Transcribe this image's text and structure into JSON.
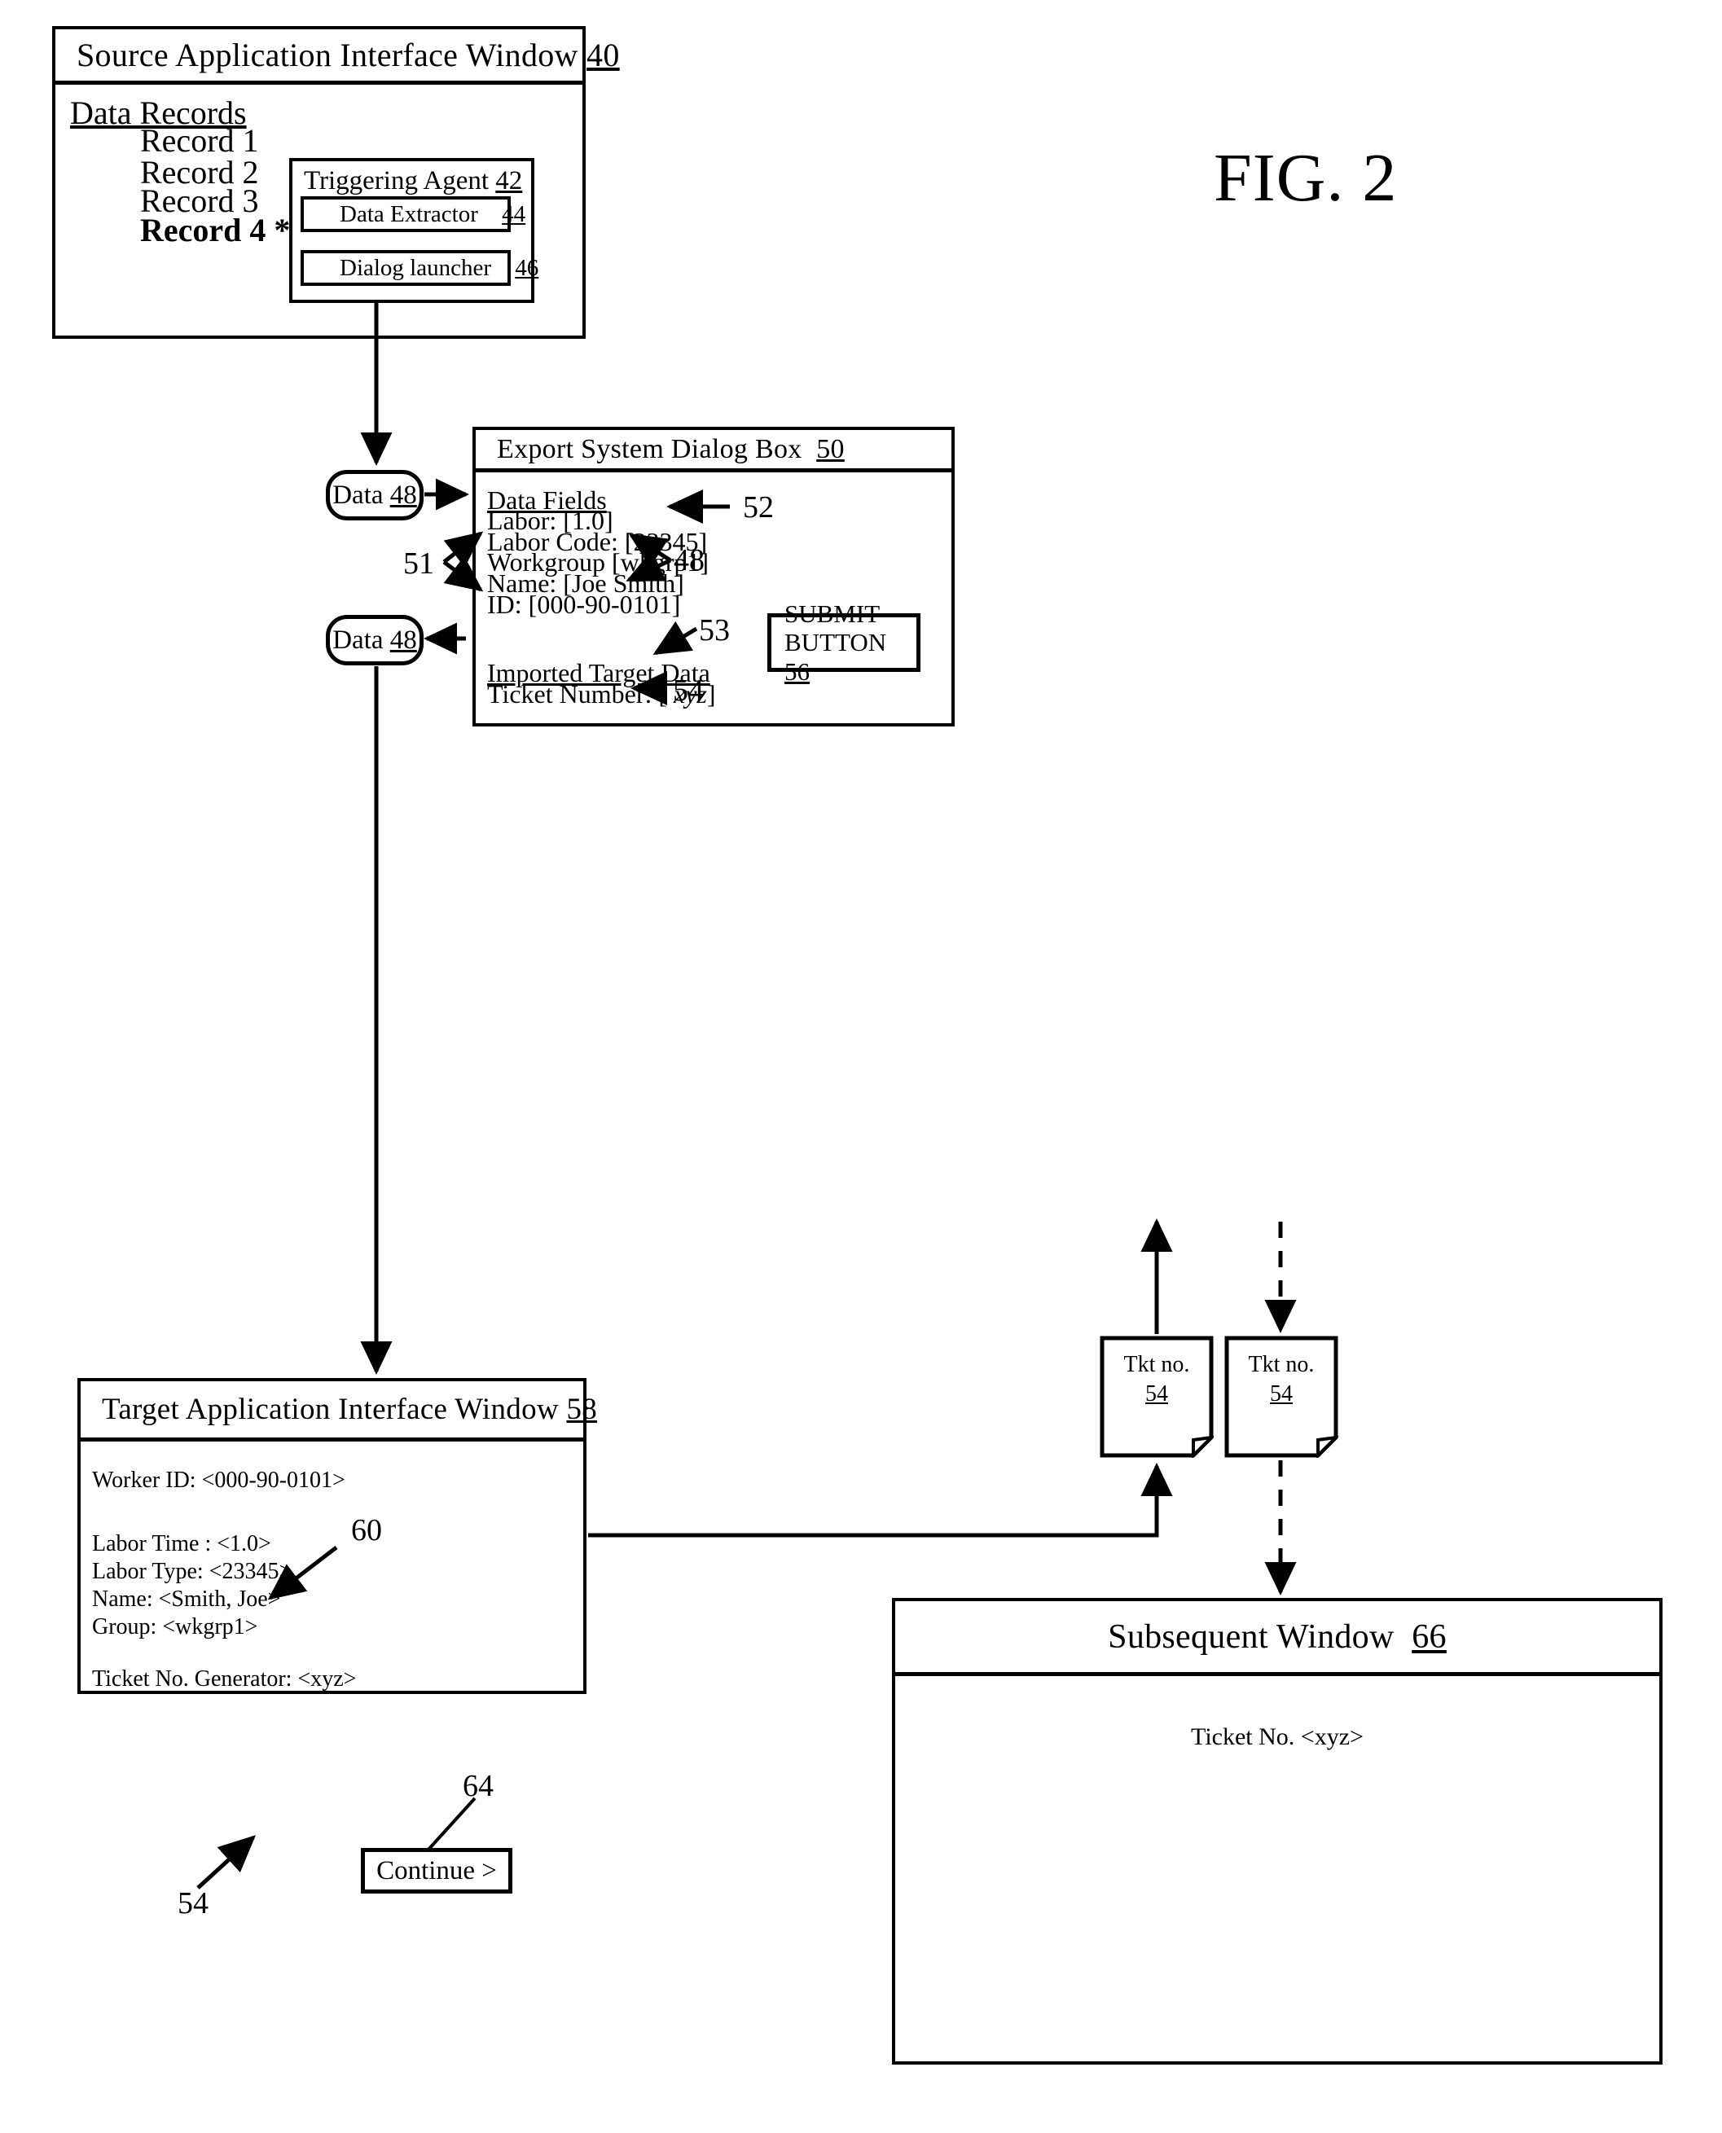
{
  "figure": {
    "label": "FIG. 2"
  },
  "source_window": {
    "title": "Source Application Interface Window 40",
    "title_text": "Source Application Interface Window",
    "title_ref": "40",
    "section_heading": "Data Records",
    "records": [
      {
        "label": "Record 1",
        "selected": false
      },
      {
        "label": "Record 2",
        "selected": false
      },
      {
        "label": "Record 3",
        "selected": false
      },
      {
        "label": "Record 4 *",
        "selected": true
      }
    ]
  },
  "triggering_agent": {
    "title_text": "Triggering Agent",
    "title_ref": "42",
    "components": [
      {
        "label_text": "Data Extractor",
        "ref": "44"
      },
      {
        "label_text": "Dialog launcher",
        "ref": "46"
      }
    ]
  },
  "data_nodes": [
    {
      "label_text": "Data",
      "ref": "48"
    },
    {
      "label_text": "Data",
      "ref": "48"
    }
  ],
  "export_dialog": {
    "title_text": "Export System Dialog Box",
    "title_ref": "50",
    "data_fields_heading": "Data Fields",
    "data_fields": [
      "Labor: [1.0]",
      "Labor Code: [23345]",
      "Workgroup [wkgrp1]",
      "Name: [Joe Smith]",
      "ID: [000-90-0101]"
    ],
    "imported_heading": "Imported Target Data",
    "imported_label": "Ticket Number: [ ",
    "imported_value": "xyz",
    "imported_close": "]",
    "submit_button_line1": "SUBMIT",
    "submit_button_line2": "BUTTON",
    "submit_button_ref": "56"
  },
  "target_window": {
    "title_text": "Target Application Interface Window",
    "title_ref": "58",
    "worker_id": "Worker ID:  <000-90-0101>",
    "fields": [
      "Labor Time :  <1.0>",
      "Labor Type:  <23345>",
      "Name: <Smith, Joe>",
      "Group: <wkgrp1>"
    ],
    "ticket_generator": "Ticket No. Generator: <xyz>",
    "continue_button": "Continue  >"
  },
  "ticket_notes": [
    {
      "line1": "Tkt no.",
      "line2": "54"
    },
    {
      "line1": "Tkt no.",
      "line2": "54"
    }
  ],
  "subsequent_window": {
    "title_text": "Subsequent Window",
    "title_ref": "66",
    "body_text": "Ticket No. <xyz>"
  },
  "reference_numerals": {
    "n51": "51",
    "n52": "52",
    "n48a": "48",
    "n53": "53",
    "n54a": "54",
    "n60": "60",
    "n64": "64",
    "n54b": "54"
  },
  "colors": {
    "ink": "#000000",
    "paper": "#ffffff"
  }
}
